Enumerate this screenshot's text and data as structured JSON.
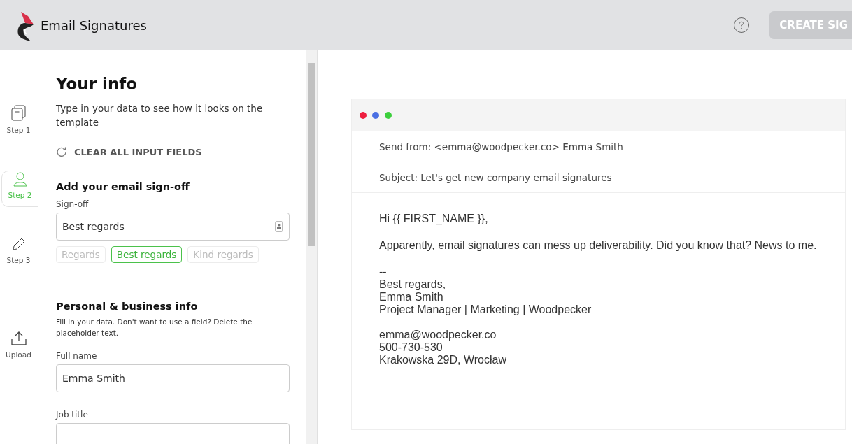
{
  "header": {
    "title": "Email Signatures",
    "create_button": "CREATE SIG"
  },
  "steps": [
    {
      "label": "Step 1",
      "kind": "template",
      "selected": false
    },
    {
      "label": "Step 2",
      "kind": "person",
      "selected": true
    },
    {
      "label": "Step 3",
      "kind": "pencil",
      "selected": false
    },
    {
      "label": "Upload",
      "kind": "upload",
      "selected": false
    }
  ],
  "form": {
    "title": "Your info",
    "subtitle": "Type in your data to see how it looks on the template",
    "clear_button": "CLEAR ALL INPUT FIELDS",
    "signoff_section": {
      "title": "Add your email sign-off",
      "label": "Sign-off",
      "value": "Best regards",
      "options": [
        {
          "label": "Regards",
          "selected": false
        },
        {
          "label": "Best regards",
          "selected": true
        },
        {
          "label": "Kind regards",
          "selected": false
        }
      ]
    },
    "personal_section": {
      "title": "Personal & business info",
      "hint": "Fill in your data. Don't want to use a field? Delete the placeholder text.",
      "fields": [
        {
          "label": "Full name",
          "value": "Emma Smith"
        },
        {
          "label": "Job title"
        }
      ]
    }
  },
  "preview": {
    "from": "Send from: <emma@woodpecker.co> Emma Smith",
    "subject": "Subject: Let's get new company email signatures",
    "greeting": "Hi {{ FIRST_NAME }},",
    "body": "Apparently, email signatures can mess up deliverability. Did you know that? News to me.",
    "signature": [
      "--",
      "Best regards,",
      "Emma Smith",
      "Project Manager | Marketing | Woodpecker"
    ],
    "contact": [
      "emma@woodpecker.co",
      "500-730-530",
      "Krakowska 29D, Wrocław"
    ]
  }
}
